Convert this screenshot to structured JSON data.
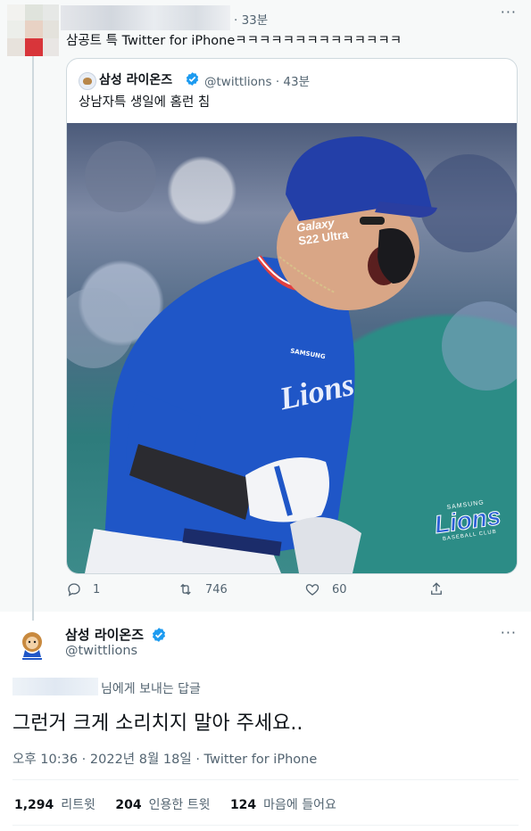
{
  "reply": {
    "time": "· 33분",
    "text": "삼공트 특 Twitter for iPhoneㅋㅋㅋㅋㅋㅋㅋㅋㅋㅋㅋㅋㅋㅋ",
    "more": "···"
  },
  "quote": {
    "name": "삼성 라이온즈",
    "handle": "@twittlions · 43분",
    "text": "상남자특 생일에 홈런 침",
    "image_text": {
      "helmet_brand": "Galaxy",
      "helmet_model": "S22 Ultra",
      "jersey_brand": "SAMSUNG",
      "jersey_team": "Lions",
      "logo_top": "SAMSUNG",
      "logo_main": "Lions",
      "logo_bottom": "BASEBALL CLUB"
    }
  },
  "reply_actions": {
    "replies": "1",
    "retweets": "746",
    "likes": "60"
  },
  "main": {
    "name": "삼성 라이온즈",
    "handle": "@twittlions",
    "more": "···",
    "reply_to": "님에게 보내는 답글",
    "text": "그런거 크게 소리치지 말아 주세요..",
    "meta": "오후 10:36 · 2022년 8월 18일 · Twitter for iPhone",
    "stats": {
      "retweets_count": "1,294",
      "retweets_label": "리트윗",
      "quotes_count": "204",
      "quotes_label": "인용한 트윗",
      "likes_count": "124",
      "likes_label": "마음에 들어요"
    }
  },
  "colors": {
    "verified": "#1d9bf0",
    "text": "#0f1419",
    "muted": "#536471",
    "jersey_blue": "#1f56c7"
  }
}
